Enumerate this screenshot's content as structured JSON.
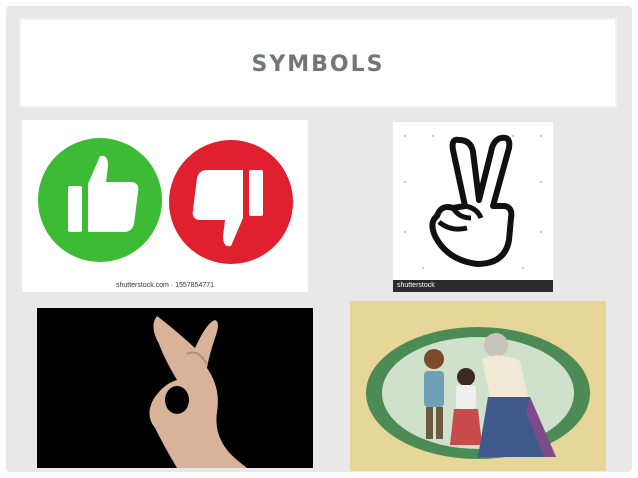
{
  "slide": {
    "title": "SYMBOLS"
  },
  "images": {
    "thumbs": {
      "caption": "shutterstock.com · 1557854771",
      "colors": {
        "thumbs_up_bg": "#3dbb34",
        "thumbs_down_bg": "#e0202e"
      }
    },
    "peace": {
      "caption": "shutterstock"
    },
    "ok_hand": {},
    "illustration": {}
  }
}
